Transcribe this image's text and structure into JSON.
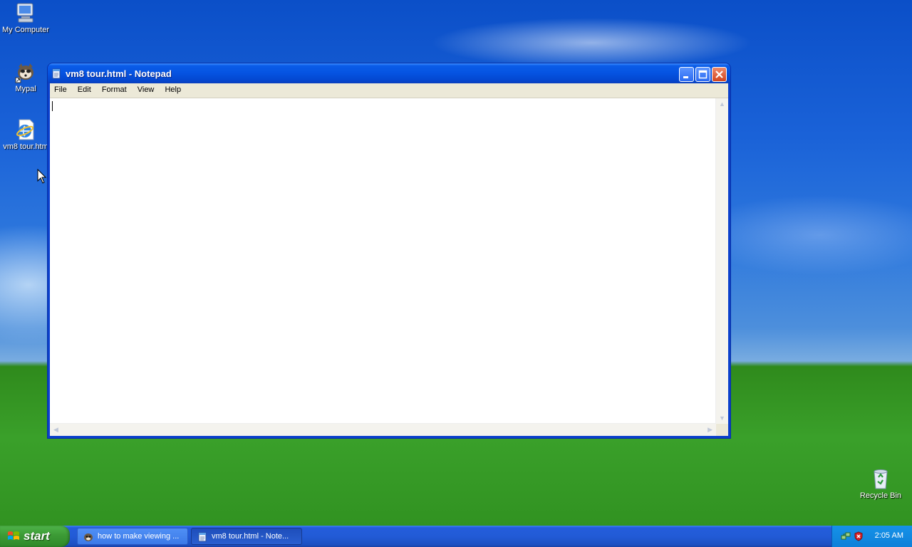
{
  "desktop": {
    "icons": [
      {
        "label": "My Computer",
        "icon": "my-computer-icon"
      },
      {
        "label": "Mypal",
        "icon": "mypal-icon"
      },
      {
        "label": "vm8 tour.htm",
        "icon": "internet-explorer-icon"
      },
      {
        "label": "Recycle Bin",
        "icon": "recycle-bin-icon"
      }
    ]
  },
  "window": {
    "title": "vm8 tour.html - Notepad",
    "buttons": {
      "minimize": "minimize",
      "maximize": "maximize",
      "close": "close"
    },
    "menu": [
      "File",
      "Edit",
      "Format",
      "View",
      "Help"
    ],
    "content": ""
  },
  "taskbar": {
    "start_label": "start",
    "tasks": [
      {
        "label": "how to make viewing ...",
        "icon": "mypal-icon",
        "active": false
      },
      {
        "label": "vm8 tour.html - Note...",
        "icon": "notepad-icon",
        "active": true
      }
    ],
    "clock": "2:05 AM"
  },
  "colors": {
    "titlebar": "#0553e1",
    "taskbar": "#245ddb",
    "start": "#3c9a35",
    "tray": "#0f80d9"
  }
}
